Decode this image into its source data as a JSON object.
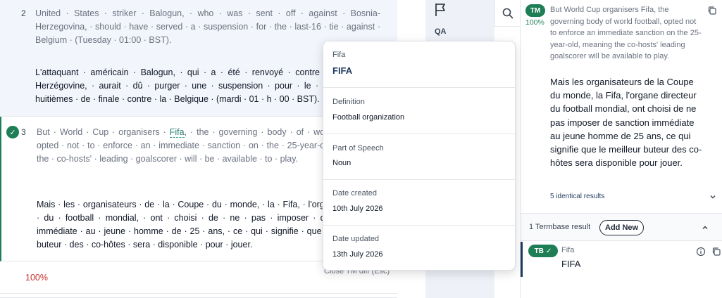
{
  "segments": [
    {
      "number": "2",
      "source": "United · States · striker · Balogun, · who · was · sent · off · against · Bosnia-Herzegovina, · should · have · served · a · suspension · for · the · last-16 · tie · against · Belgium · (Tuesday · 01:00 · BST).",
      "target": "L'attaquant · américain · Balogun, · qui · a · été · renvoyé · contre · la · Bosnie-Herzégovine, · aurait · dû · purger · une · suspension · pour · le · match · des · huitièmes · de · finale · contre · la · Belgique · (mardi · 01 · h · 00 · BST)."
    },
    {
      "number": "3",
      "source_before": "But · World · Cup · organisers · ",
      "source_term": "Fifa",
      "source_after": ", · the · governing · body · of · world · football, · opted · not · to · enforce · an · immediate · sanction · on · the · 25-year-old, · meaning · the · co-hosts' · leading · goalscorer · will · be · available · to · play.",
      "target": "Mais · les · organisateurs · de · la · Coupe · du · monde, · la · Fifa, · l'organe · directeur · du · football · mondial, · ont · choisi · de · ne · pas · imposer · de · sanction · immédiate · au · jeune · homme · de · 25 · ans, · ce · qui · signifie · que · le · meilleur · buteur · des · co-hôtes · sera · disponible · pour · jouer."
    }
  ],
  "segment4": {
    "match_percent": "100%",
    "close_tm": "Close TM diff (Esc)"
  },
  "side_strip": {
    "qa_label": "QA"
  },
  "popup": {
    "term_label": "Fifa",
    "term_value": "FIFA",
    "definition_label": "Definition",
    "definition_value": "Football organization",
    "pos_label": "Part of Speech",
    "pos_value": "Noun",
    "created_label": "Date created",
    "created_value": "10th July 2026",
    "updated_label": "Date updated",
    "updated_value": "13th July 2026"
  },
  "tm_match": {
    "badge": "TM",
    "percent": "100%",
    "source": "But World Cup organisers Fifa, the governing body of world football, opted not to enforce an immediate sanction on the 25-year-old, meaning the co-hosts' leading goalscorer will be available to play.",
    "target": "Mais les organisateurs de la Coupe du monde, la Fifa, l'organe directeur du football mondial, ont choisi de ne pas imposer de sanction immédiate au jeune homme de 25 ans, ce qui signifie que le meilleur buteur des co-hôtes sera disponible pour jouer.",
    "identical_results": "5 identical results"
  },
  "termbase": {
    "result_count": "1 Termbase result",
    "add_new": "Add New",
    "badge": "TB",
    "source": "Fifa",
    "target": "FIFA"
  },
  "colors": {
    "accent_green": "#1e7e55",
    "match_red": "#c53030",
    "navy": "#1f3a5f"
  }
}
